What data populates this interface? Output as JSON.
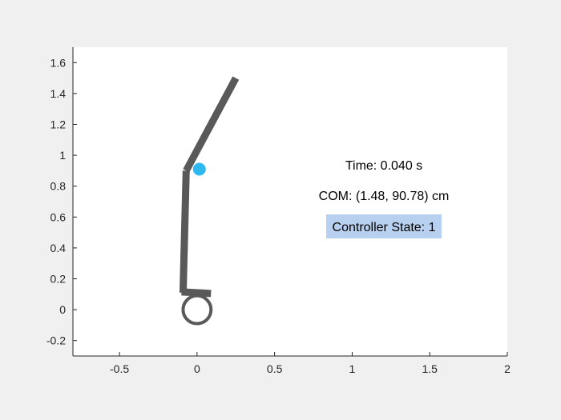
{
  "chart_data": {
    "type": "scatter",
    "title": "",
    "xlabel": "",
    "ylabel": "",
    "xlim": [
      -0.8,
      2.0
    ],
    "ylim": [
      -0.3,
      1.7
    ],
    "x_ticks": [
      -0.5,
      0,
      0.5,
      1,
      1.5,
      2
    ],
    "x_tick_labels": [
      "-0.5",
      "0",
      "0.5",
      "1",
      "1.5",
      "2"
    ],
    "y_ticks": [
      -0.2,
      0,
      0.2,
      0.4,
      0.6,
      0.8,
      1.0,
      1.2,
      1.4,
      1.6
    ],
    "y_tick_labels": [
      "-0.2",
      "0",
      "0.2",
      "0.4",
      "0.6",
      "0.8",
      "1",
      "1.2",
      "1.4",
      "1.6"
    ],
    "grid": false,
    "colors": {
      "axes_background": "#ffffff",
      "figure_background": "#f0f0f0",
      "link": "#595959",
      "com_marker": "#2eb8ef",
      "state_box": "#b8d0f0",
      "axis": "#262626"
    },
    "links": [
      {
        "x": [
          0.25,
          -0.07
        ],
        "y": [
          1.5,
          0.9
        ]
      },
      {
        "x": [
          -0.07,
          -0.09
        ],
        "y": [
          0.9,
          0.11
        ]
      },
      {
        "x": [
          -0.1,
          0.09
        ],
        "y": [
          0.115,
          0.105
        ]
      }
    ],
    "wheel": {
      "x": 0.0,
      "y": 0.0,
      "r": 0.09
    },
    "com_point": {
      "x": 0.015,
      "y": 0.91
    },
    "annotations": {
      "time": "Time: 0.040 s",
      "com": "COM: (1.48, 90.78) cm",
      "controller_state": "Controller State: 1"
    }
  }
}
